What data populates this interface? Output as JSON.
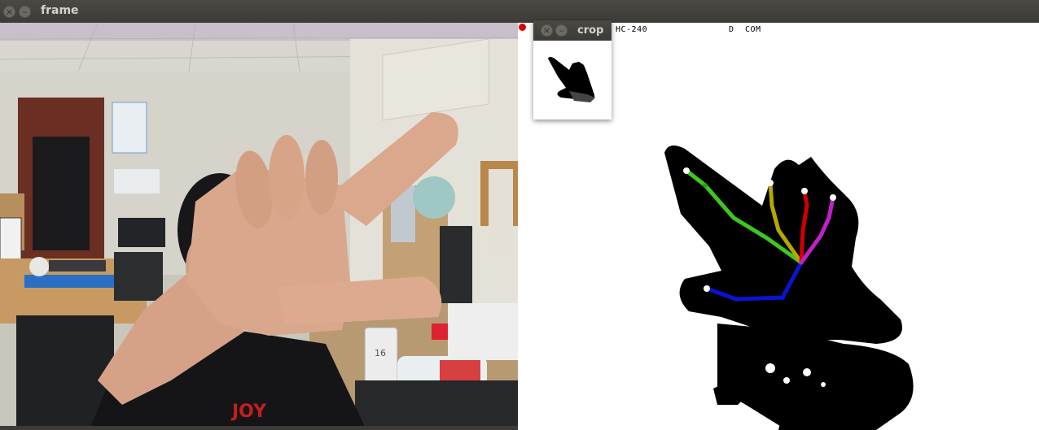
{
  "main_window": {
    "title": "frame",
    "close_glyph": "×",
    "minimize_glyph": "–"
  },
  "crop_window": {
    "title": "crop",
    "close_glyph": "×",
    "minimize_glyph": "–"
  },
  "mask_hud": {
    "label_left": "HC-240",
    "label_mid": "D",
    "label_right": "COM"
  },
  "mug_text": "16",
  "shirt_text": "JOY",
  "colors": {
    "titlebar": "#3c3b37",
    "mask_bg": "#ffffff",
    "hand_blob": "#000000",
    "marker": "#e00000",
    "finger_thumb": "#0a14d0",
    "finger_index": "#3cc81e",
    "finger_middle": "#b4a800",
    "finger_ring": "#d00000",
    "finger_pinky": "#c020c8"
  },
  "icons": [
    "close-icon",
    "minimize-icon",
    "red-dot-marker"
  ]
}
